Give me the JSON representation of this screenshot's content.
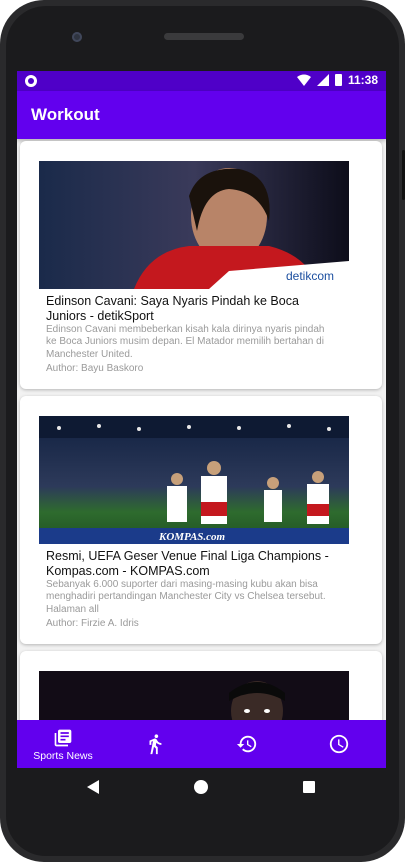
{
  "status": {
    "time": "11:38"
  },
  "appbar": {
    "title": "Workout"
  },
  "articles": [
    {
      "title": "Edinson Cavani: Saya Nyaris Pindah ke Boca Juniors - detikSport",
      "description": "Edinson Cavani membeberkan kisah kala dirinya nyaris pindah ke Boca Juniors musim depan. El Matador memilih bertahan di Manchester United.",
      "author": "Author: Bayu Baskoro",
      "image_watermark": "detikcom"
    },
    {
      "title": "Resmi, UEFA Geser Venue Final Liga Champions - Kompas.com - KOMPAS.com",
      "description": "Sebanyak 6.000 suporter dari masing-masing kubu akan bisa menghadiri pertandingan Manchester City vs Chelsea tersebut. Halaman all",
      "author": "Author: Firzie A. Idris",
      "image_watermark": "KOMPAS.com"
    },
    {
      "title": "",
      "description": "",
      "author": ""
    }
  ],
  "bottom_nav": {
    "items": [
      {
        "label": "Sports News",
        "icon": "newspaper-icon",
        "active": true
      },
      {
        "label": "",
        "icon": "run-icon",
        "active": false
      },
      {
        "label": "",
        "icon": "history-icon",
        "active": false
      },
      {
        "label": "",
        "icon": "clock-icon",
        "active": false
      }
    ]
  },
  "colors": {
    "statusbar": "#4f00c8",
    "primary": "#6200ee"
  }
}
